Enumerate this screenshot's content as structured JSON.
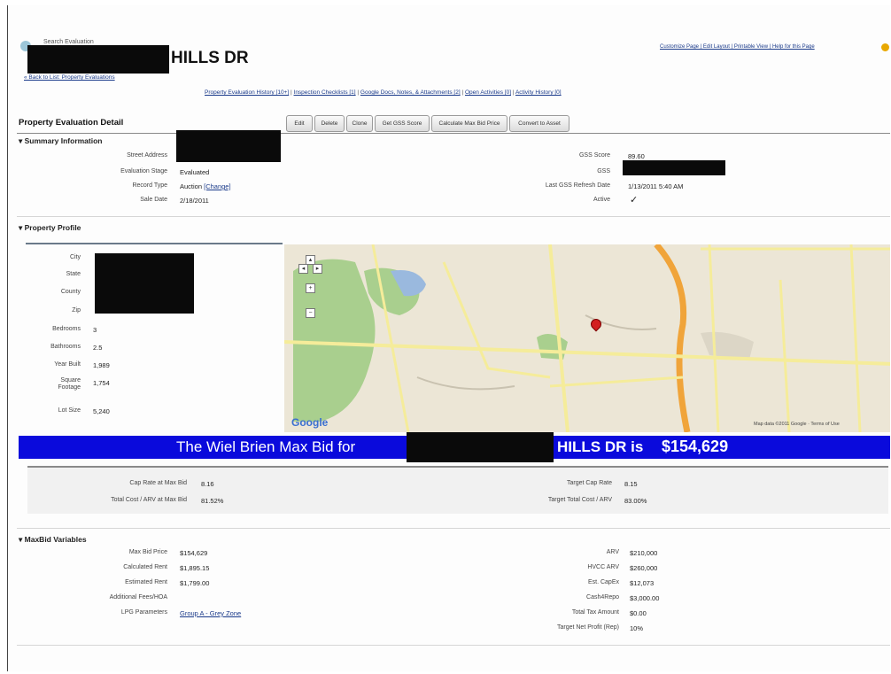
{
  "header": {
    "breadcrumb_top": "Search Evaluation",
    "back_link": "« Back to List: Property Evaluations",
    "title_suffix": "HILLS DR",
    "top_links": "Customize Page | Edit Layout | Printable View | Help for this Page"
  },
  "related_links": [
    "Property Evaluation History [10+]",
    "Inspection Checklists [1]",
    "Google Docs, Notes, & Attachments [2]",
    "Open Activities [0]",
    "Activity History [0]"
  ],
  "detail": {
    "heading": "Property Evaluation Detail",
    "buttons": [
      "Edit",
      "Delete",
      "Clone",
      "Get GSS Score",
      "Calculate Max Bid Price",
      "Convert to Asset"
    ]
  },
  "summary": {
    "heading": "Summary Information",
    "left": [
      {
        "label": "Street Address",
        "value": ""
      },
      {
        "label": "Evaluation Stage",
        "value": "Evaluated"
      },
      {
        "label": "Record Type",
        "value": "Auction",
        "link": "[Change]"
      },
      {
        "label": "Sale Date",
        "value": "2/18/2011"
      }
    ],
    "right": [
      {
        "label": "GSS Score",
        "value": "89.60"
      },
      {
        "label": "GSS",
        "value": ""
      },
      {
        "label": "Last GSS Refresh Date",
        "value": "1/13/2011 5:40 AM"
      },
      {
        "label": "Active",
        "value": "✓"
      }
    ]
  },
  "profile": {
    "heading": "Property Profile",
    "fields": [
      {
        "label": "City",
        "value": ""
      },
      {
        "label": "State",
        "value": ""
      },
      {
        "label": "County",
        "value": ""
      },
      {
        "label": "Zip",
        "value": ""
      },
      {
        "label": "Bedrooms",
        "value": "3"
      },
      {
        "label": "Bathrooms",
        "value": "2.5"
      },
      {
        "label": "Year Built",
        "value": "1,989"
      },
      {
        "label": "Square Footage",
        "value": "1,754"
      },
      {
        "label": "Lot Size",
        "value": "5,240"
      }
    ],
    "map": {
      "logo": "Google",
      "copyright": "Map data ©2011 Google · Terms of Use"
    }
  },
  "banner": {
    "prefix": "The Wiel Brien Max Bid for",
    "suffix": "HILLS DR is",
    "amount": "$154,629",
    "bg_color": "#0a0adc"
  },
  "metrics": {
    "left": [
      {
        "label": "Cap Rate at Max Bid",
        "value": "8.16"
      },
      {
        "label": "Total Cost / ARV at Max Bid",
        "value": "81.52%"
      }
    ],
    "right": [
      {
        "label": "Target Cap Rate",
        "value": "8.15"
      },
      {
        "label": "Target Total Cost / ARV",
        "value": "83.00%"
      }
    ]
  },
  "maxbid": {
    "heading": "MaxBid Variables",
    "left": [
      {
        "label": "Max Bid Price",
        "value": "$154,629"
      },
      {
        "label": "Calculated Rent",
        "value": "$1,895.15"
      },
      {
        "label": "Estimated Rent",
        "value": "$1,799.00"
      },
      {
        "label": "Additional Fees/HOA",
        "value": ""
      },
      {
        "label": "LPG Parameters",
        "value": "Group A - Grey Zone"
      }
    ],
    "right": [
      {
        "label": "ARV",
        "value": "$210,000"
      },
      {
        "label": "HVCC ARV",
        "value": "$260,000"
      },
      {
        "label": "Est. CapEx",
        "value": "$12,073"
      },
      {
        "label": "Cash4Repo",
        "value": "$3,000.00"
      },
      {
        "label": "Total Tax Amount",
        "value": "$0.00"
      },
      {
        "label": "Target Net Profit (Rep)",
        "value": "10%"
      }
    ]
  }
}
